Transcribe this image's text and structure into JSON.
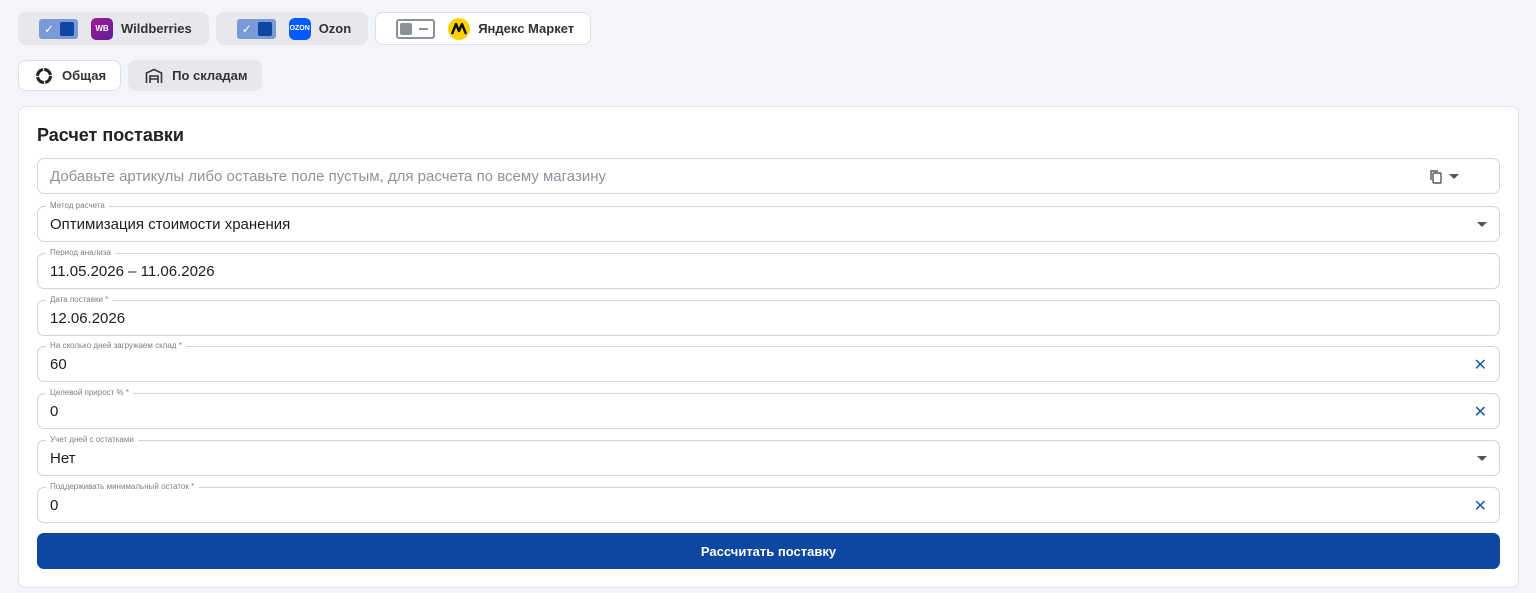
{
  "marketplaces": [
    {
      "name": "Wildberries",
      "logo": "WB",
      "enabled": true
    },
    {
      "name": "Ozon",
      "logo": "OZON",
      "enabled": true
    },
    {
      "name": "Яндекс Маркет",
      "logo": "ya-market-logo",
      "enabled": false
    }
  ],
  "views": {
    "general": "Общая",
    "by_warehouses": "По складам"
  },
  "card": {
    "title": "Расчет поставки",
    "articles_placeholder": "Добавьте артикулы либо оставьте поле пустым, для расчета по всему магазину",
    "fields": {
      "method": {
        "label": "Метод расчета",
        "value": "Оптимизация стоимости хранения"
      },
      "period": {
        "label": "Период анализа",
        "value": "11.05.2026 – 11.06.2026"
      },
      "delivery_date": {
        "label": "Дата поставки *",
        "value": "12.06.2026"
      },
      "days_load": {
        "label": "На сколько дней загружаем склад *",
        "value": "60"
      },
      "target_growth": {
        "label": "Целевой прирост % *",
        "value": "0"
      },
      "stock_days": {
        "label": "Учет дней с остатками",
        "value": "Нет"
      },
      "min_stock": {
        "label": "Поддерживать минимальный остаток *",
        "value": "0"
      }
    },
    "submit_label": "Рассчитать поставку"
  },
  "colors": {
    "primary": "#0d47a1",
    "toggle_on": "#7a99d8",
    "clear_icon": "#1e5aa8"
  }
}
